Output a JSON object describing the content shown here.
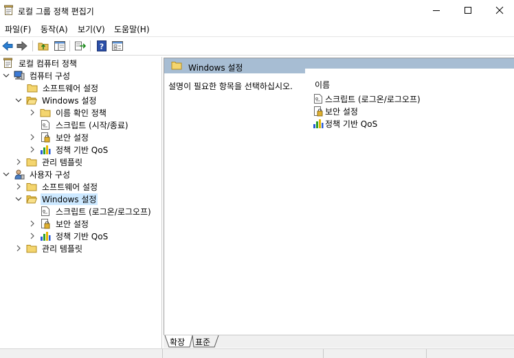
{
  "window": {
    "title": "로컬 그룹 정책 편집기"
  },
  "menu": [
    "파일(F)",
    "동작(A)",
    "보기(V)",
    "도움말(H)"
  ],
  "toolbar": [
    "back-arrow-icon",
    "forward-arrow-icon",
    "up-folder-icon",
    "show-hide-tree-icon",
    "export-list-icon",
    "help-icon",
    "properties-icon"
  ],
  "tree": {
    "root": "로컬 컴퓨터 정책",
    "computer": "컴퓨터 구성",
    "computer_software": "소프트웨어 설정",
    "computer_windows": "Windows 설정",
    "computer_name_resolution": "이름 확인 정책",
    "computer_scripts": "스크립트 (시작/종료)",
    "computer_security": "보안 설정",
    "computer_qos": "정책 기반 QoS",
    "computer_admin": "관리 템플릿",
    "user": "사용자 구성",
    "user_software": "소프트웨어 설정",
    "user_windows": "Windows 설정",
    "user_scripts": "스크립트 (로그온/로그오프)",
    "user_security": "보안 설정",
    "user_qos": "정책 기반 QoS",
    "user_admin": "관리 템플릿"
  },
  "right": {
    "header": "Windows 설정",
    "description": "설명이 필요한 항목을 선택하십시오.",
    "column": "이름",
    "items": [
      "스크립트 (로그온/로그오프)",
      "보안 설정",
      "정책 기반 QoS"
    ]
  },
  "tabs": {
    "extended": "확장",
    "standard": "표준"
  }
}
